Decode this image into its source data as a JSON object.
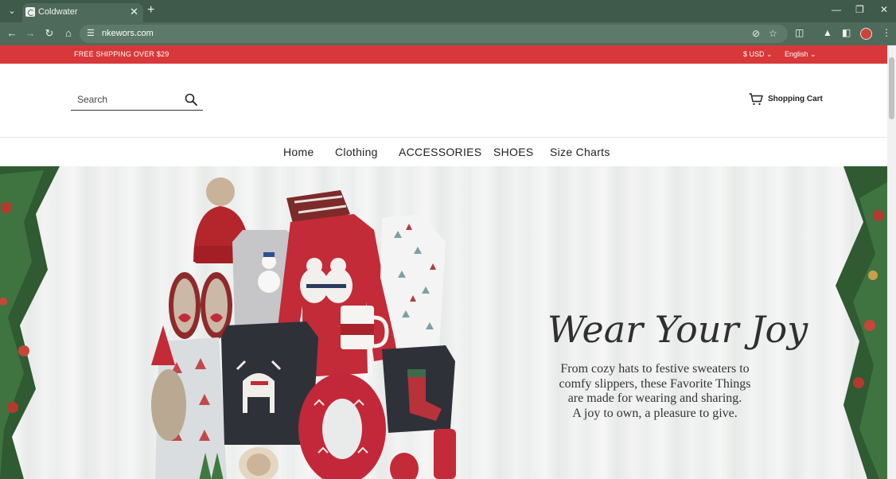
{
  "browser": {
    "tab_title": "Coldwater",
    "url": "nkewors.com",
    "tab_close": "✕",
    "new_tab": "+",
    "tab_dropdown": "⌄",
    "win_minimize": "—",
    "win_restore": "❐",
    "win_close": "✕",
    "icons": [
      "back-icon",
      "forward-icon",
      "reload-icon",
      "home-icon",
      "site-info-icon",
      "eye-off-icon",
      "star-icon",
      "extensions-icon",
      "labs-icon",
      "side-panel-icon",
      "profile-avatar",
      "menu-icon"
    ]
  },
  "promo": {
    "shipping": "FREE SHIPPING OVER $29",
    "currency": "$ USD ⌄",
    "language": "English ⌄",
    "bg_color": "#d8383a"
  },
  "header": {
    "search_placeholder": "Search",
    "cart_label": "Shopping Cart"
  },
  "menu": {
    "items": [
      "Home",
      "Clothing",
      "ACCESSORIES",
      "SHOES",
      "Size Charts"
    ]
  },
  "hero": {
    "title": "Wear Your Joy",
    "body_lines": [
      "From cozy hats to festive sweaters to",
      "comfy slippers, these Favorite Things",
      "are made for wearing and sharing.",
      "A joy to own, a pleasure to give."
    ]
  }
}
